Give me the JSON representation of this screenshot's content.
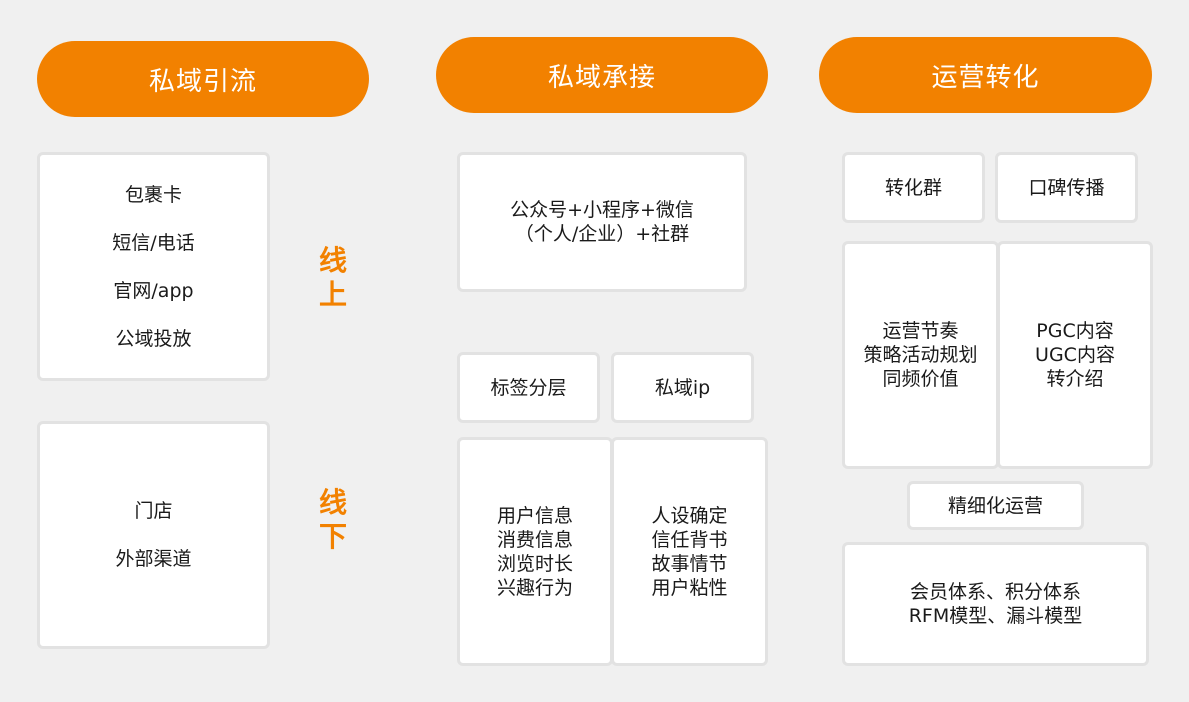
{
  "columns": [
    {
      "header": "私域引流",
      "online_items": [
        "包裹卡",
        "短信/电话",
        "官网/app",
        "公域投放"
      ],
      "offline_items": [
        "门店",
        "外部渠道"
      ]
    },
    {
      "header": "私域承接",
      "top_box": [
        "公众号+小程序+微信",
        "（个人/企业）+社群"
      ],
      "tag_left": "标签分层",
      "tag_right": "私域ip",
      "bottom_left": [
        "用户信息",
        "消费信息",
        "浏览时长",
        "兴趣行为"
      ],
      "bottom_right": [
        "人设确定",
        "信任背书",
        "故事情节",
        "用户粘性"
      ]
    },
    {
      "header": "运营转化",
      "tag_left": "转化群",
      "tag_right": "口碑传播",
      "mid_left": [
        "运营节奏",
        "策略活动规划",
        "同频价值"
      ],
      "mid_right": [
        "PGC内容",
        "UGC内容",
        "转介绍"
      ],
      "refine": "精细化运营",
      "bottom": [
        "会员体系、积分体系",
        "RFM模型、漏斗模型"
      ]
    }
  ],
  "side_labels": {
    "online": [
      "线",
      "上"
    ],
    "offline": [
      "线",
      "下"
    ]
  },
  "colors": {
    "accent": "#f28100",
    "background": "#f0f0f0",
    "card": "#ffffff",
    "card_border": "#e2e2e2"
  }
}
